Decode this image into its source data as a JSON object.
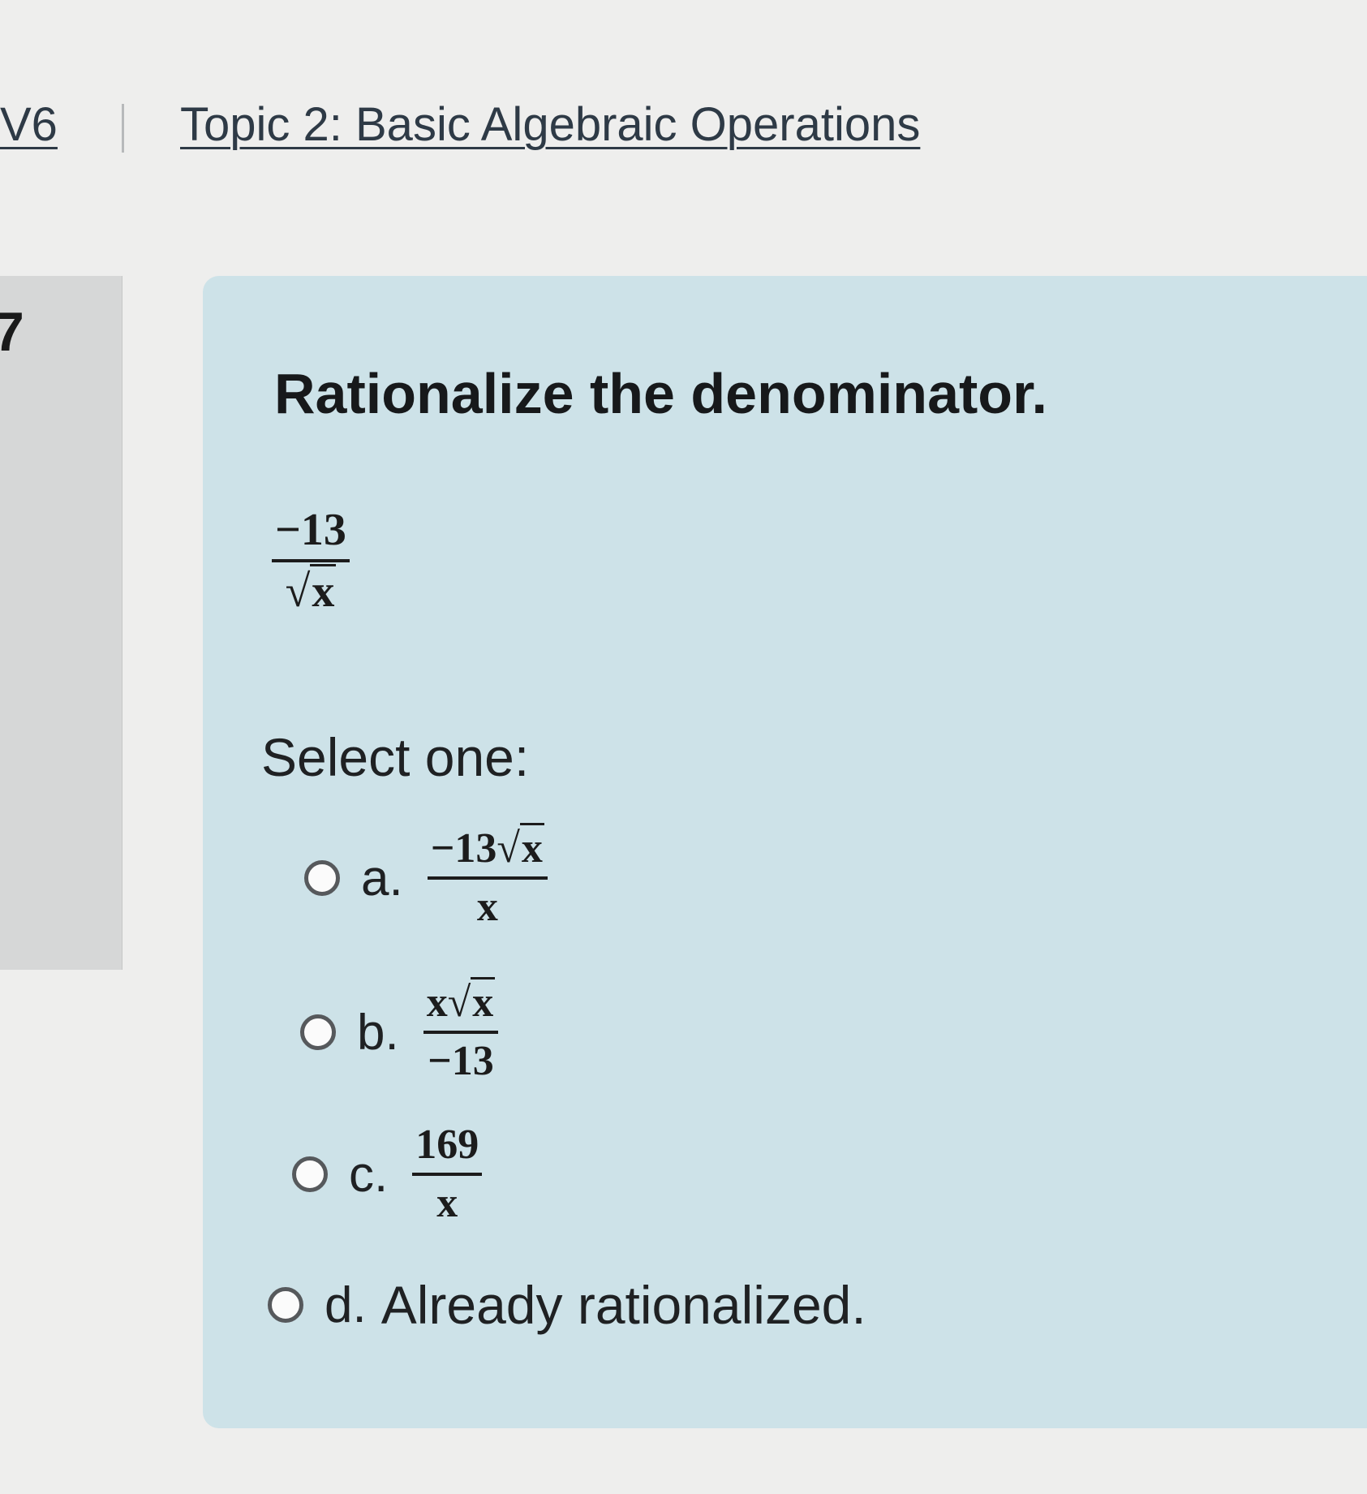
{
  "breadcrumb": {
    "course": "V6",
    "topic": "Topic 2: Basic Algebraic Operations"
  },
  "question": {
    "number": "7",
    "text": "Rationalize the denominator.",
    "expression": {
      "numerator": "−13",
      "radical_symbol": "√",
      "radicand": "x"
    },
    "prompt": "Select one:"
  },
  "options": [
    {
      "letter": "a.",
      "numerator": "−13",
      "radical_symbol": "√",
      "radicand": "x",
      "denominator": "x",
      "selected": false
    },
    {
      "letter": "b.",
      "numerator": "x",
      "radical_symbol": "√",
      "radicand": "x",
      "denominator": "−13",
      "selected": false
    },
    {
      "letter": "c.",
      "numerator": "169",
      "denominator": "x",
      "selected": false
    },
    {
      "letter": "d.",
      "text": "Already rationalized.",
      "selected": false
    }
  ],
  "colors": {
    "page_background": "#eeeeed",
    "question_panel": "#cde2e8",
    "info_panel": "#d6d7d7",
    "link_text": "#2e3a46"
  }
}
